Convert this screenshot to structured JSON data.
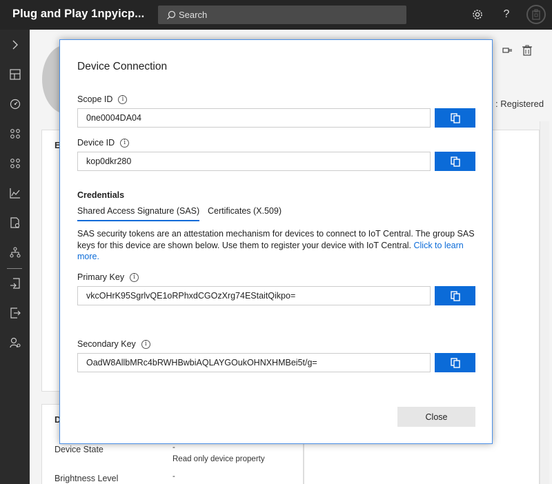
{
  "header": {
    "app_title": "Plug and Play 1npyicp...",
    "search_placeholder": "Search"
  },
  "background": {
    "status_text": ": Registered",
    "card1_letter": "E",
    "card2_letter": "D",
    "properties": [
      {
        "label": "Device State",
        "value": "-",
        "note": "Read only device property"
      },
      {
        "label": "Brightness Level",
        "value": "-"
      }
    ]
  },
  "dialog": {
    "title": "Device Connection",
    "scope_id_label": "Scope ID",
    "scope_id_value": "0ne0004DA04",
    "device_id_label": "Device ID",
    "device_id_value": "kop0dkr280",
    "credentials_title": "Credentials",
    "tabs": [
      {
        "label": "Shared Access Signature (SAS)",
        "active": true
      },
      {
        "label": "Certificates (X.509)",
        "active": false
      }
    ],
    "sas_description": "SAS security tokens are an attestation mechanism for devices to connect to IoT Central. The group SAS keys for this device are shown below. Use them to register your device with IoT Central.",
    "learn_more_link": "Click to learn more.",
    "primary_key_label": "Primary Key",
    "primary_key_value": "vkcOHrK95SgrlvQE1oRPhxdCGOzXrg74EStaitQikpo=",
    "secondary_key_label": "Secondary Key",
    "secondary_key_value": "OadW8AllbMRc4bRWHBwbiAQLAYGOukOHNXHMBei5t/g=",
    "close_label": "Close"
  },
  "colors": {
    "accent": "#0b6bd8",
    "topbar": "#252525",
    "leftnav": "#2b2b2b"
  }
}
